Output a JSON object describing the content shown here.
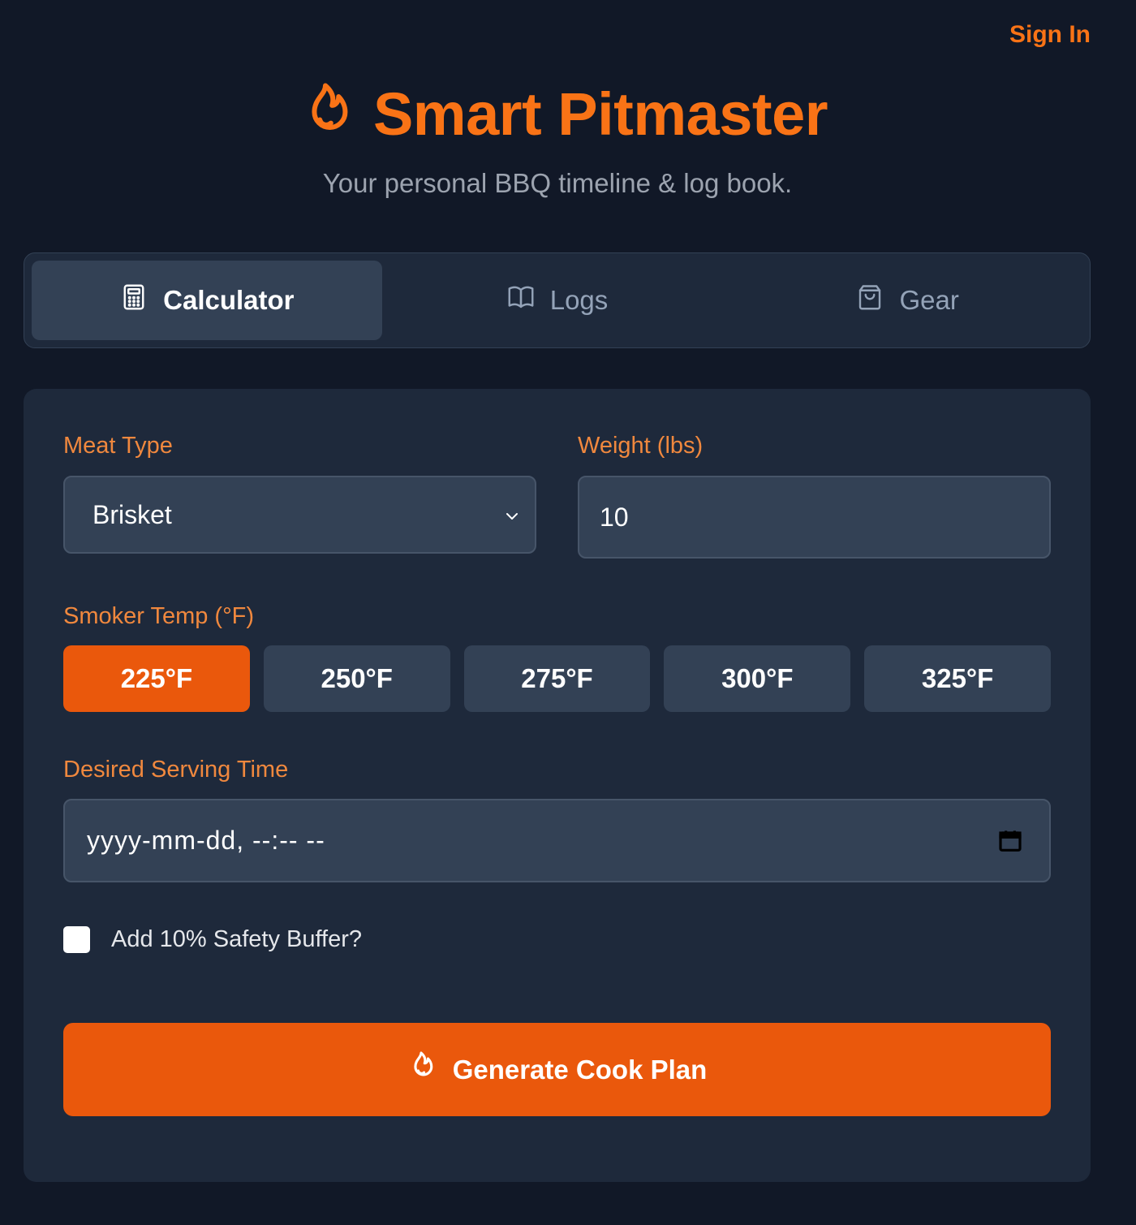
{
  "header": {
    "sign_in": "Sign In",
    "title": "Smart Pitmaster",
    "subtitle": "Your personal BBQ timeline & log book.",
    "logo_icon": "flame-icon"
  },
  "tabs": [
    {
      "label": "Calculator",
      "icon": "calculator-icon",
      "active": true
    },
    {
      "label": "Logs",
      "icon": "book-icon",
      "active": false
    },
    {
      "label": "Gear",
      "icon": "shopping-bag-icon",
      "active": false
    }
  ],
  "form": {
    "meat_type": {
      "label": "Meat Type",
      "value": "Brisket"
    },
    "weight": {
      "label": "Weight (lbs)",
      "value": "10"
    },
    "smoker_temp": {
      "label": "Smoker Temp (°F)",
      "options": [
        "225°F",
        "250°F",
        "275°F",
        "300°F",
        "325°F"
      ],
      "selected": "225°F"
    },
    "serving_time": {
      "label": "Desired Serving Time",
      "placeholder": "yyyy-mm-dd, --:-- --"
    },
    "safety_buffer": {
      "label": "Add 10% Safety Buffer?",
      "checked": false
    },
    "submit_label": "Generate Cook Plan"
  },
  "colors": {
    "accent": "#f97316",
    "button": "#ea580c",
    "background": "#111827",
    "card": "#1e293b",
    "input": "#334155"
  }
}
